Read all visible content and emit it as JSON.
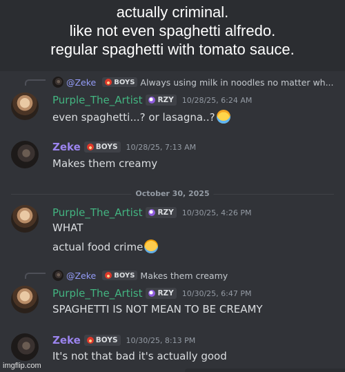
{
  "caption": {
    "lines": [
      "actually criminal.",
      "like not even spaghetti alfredo.",
      "regular spaghetti with tomato sauce."
    ]
  },
  "messages": [
    {
      "reply": {
        "mention": "@Zeke",
        "tag": "BOYS",
        "text": "Always using milk in noodles no matter wh..."
      },
      "author": "Purple_The_Artist",
      "tag": "RZY",
      "time": "10/28/25, 6:24 AM",
      "lines": [
        "even spaghetti...? or lasagna..?"
      ]
    },
    {
      "author": "Zeke",
      "tag": "BOYS",
      "time": "10/28/25, 7:13 AM",
      "lines": [
        "Makes them creamy"
      ]
    },
    {
      "author": "Purple_The_Artist",
      "tag": "RZY",
      "time": "10/30/25, 4:26 PM",
      "lines": [
        "WHAT",
        "actual food crime"
      ]
    },
    {
      "reply": {
        "mention": "@Zeke",
        "tag": "BOYS",
        "text": "Makes them creamy"
      },
      "author": "Purple_The_Artist",
      "tag": "RZY",
      "time": "10/30/25, 6:47 PM",
      "lines": [
        "SPAGHETTI IS NOT MEAN TO BE CREAMY"
      ]
    },
    {
      "author": "Zeke",
      "tag": "BOYS",
      "time": "10/30/25, 8:13 PM",
      "lines": [
        "It's not that bad it's actually good"
      ]
    }
  ],
  "date_divider": "October 30, 2025",
  "watermark": "imgflip.com",
  "icons": {
    "rzy_tag": "purple-moon-icon",
    "boys_tag": "fire-icon",
    "emoji_1": "anxious-sweat-emoji",
    "emoji_2": "loudly-crying-emoji"
  },
  "colors": {
    "background": "#313338",
    "purple_name": "#43b581",
    "zeke_name": "#9b84ee",
    "mention": "#949cf7"
  }
}
